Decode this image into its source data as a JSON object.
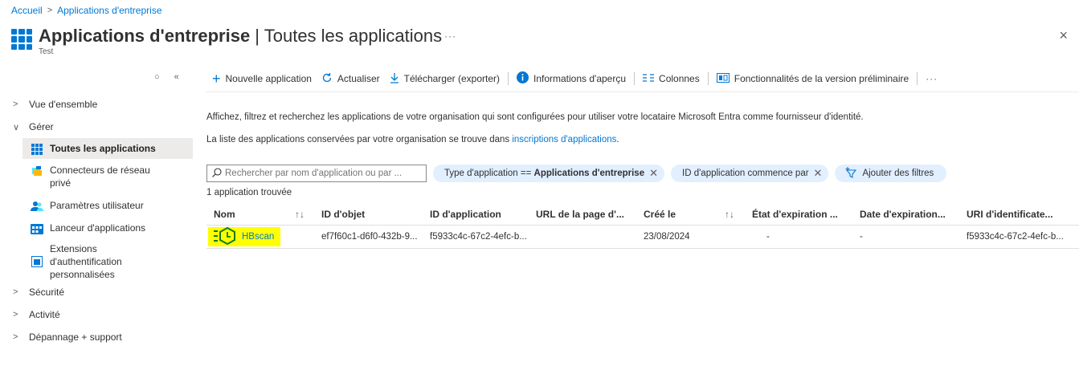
{
  "breadcrumb": {
    "home": "Accueil",
    "current": "Applications d'entreprise"
  },
  "header": {
    "title_bold": "Applications d'entreprise",
    "title_rest": " | Toutes les applications",
    "subtitle": "Test",
    "more": "···",
    "close": "×"
  },
  "sidebar_ctrls": {
    "pin": "○",
    "collapse": "«"
  },
  "sidebar": {
    "overview": "Vue d'ensemble",
    "manage": "Gérer",
    "items": [
      {
        "label": "Toutes les applications",
        "icon": "grid-icon"
      },
      {
        "label": "Connecteurs de réseau privé",
        "icon": "connector-icon"
      },
      {
        "label": "Paramètres utilisateur",
        "icon": "users-icon"
      },
      {
        "label": "Lanceur d'applications",
        "icon": "launcher-icon"
      },
      {
        "label": "Extensions d'authentification personnalisées",
        "icon": "extension-icon"
      }
    ],
    "security": "Sécurité",
    "activity": "Activité",
    "troubleshoot": "Dépannage + support"
  },
  "toolbar": {
    "new_app": "Nouvelle application",
    "refresh": "Actualiser",
    "download": "Télécharger (exporter)",
    "preview_info": "Informations d'aperçu",
    "columns": "Colonnes",
    "preview_features": "Fonctionnalités de la version préliminaire",
    "more": "···"
  },
  "description": {
    "line1": "Affichez, filtrez et recherchez les applications de votre organisation qui sont configurées pour utiliser votre locataire Microsoft Entra comme fournisseur d'identité.",
    "line2_prefix": "La liste des applications conservées par votre organisation se trouve dans ",
    "line2_link": "inscriptions d'applications",
    "line2_suffix": "."
  },
  "filters": {
    "search_placeholder": "Rechercher par nom d'application ou par ...",
    "pill1_prefix": "Type d'application == ",
    "pill1_value": "Applications d'entreprise",
    "pill2": "ID d'application commence par",
    "add": "Ajouter des filtres"
  },
  "result_count": "1 application trouvée",
  "table": {
    "headers": {
      "name": "Nom",
      "object_id": "ID d'objet",
      "app_id": "ID d'application",
      "homepage": "URL de la page d'...",
      "created": "Créé le",
      "expiration_status": "État d'expiration ...",
      "expiration_date": "Date d'expiration...",
      "identifier_uri": "URI d'identificate..."
    },
    "sort_glyph": "↑↓",
    "rows": [
      {
        "name": "HBscan",
        "object_id": "ef7f60c1-d6f0-432b-9...",
        "app_id": "f5933c4c-67c2-4efc-b...",
        "homepage": "",
        "created": "23/08/2024",
        "expiration_status": "-",
        "expiration_date": "-",
        "identifier_uri": "f5933c4c-67c2-4efc-b..."
      }
    ]
  },
  "colors": {
    "accent": "#0078d4",
    "highlight": "#ffff00",
    "pill": "#e1efff",
    "app_icon": "#107c10"
  }
}
